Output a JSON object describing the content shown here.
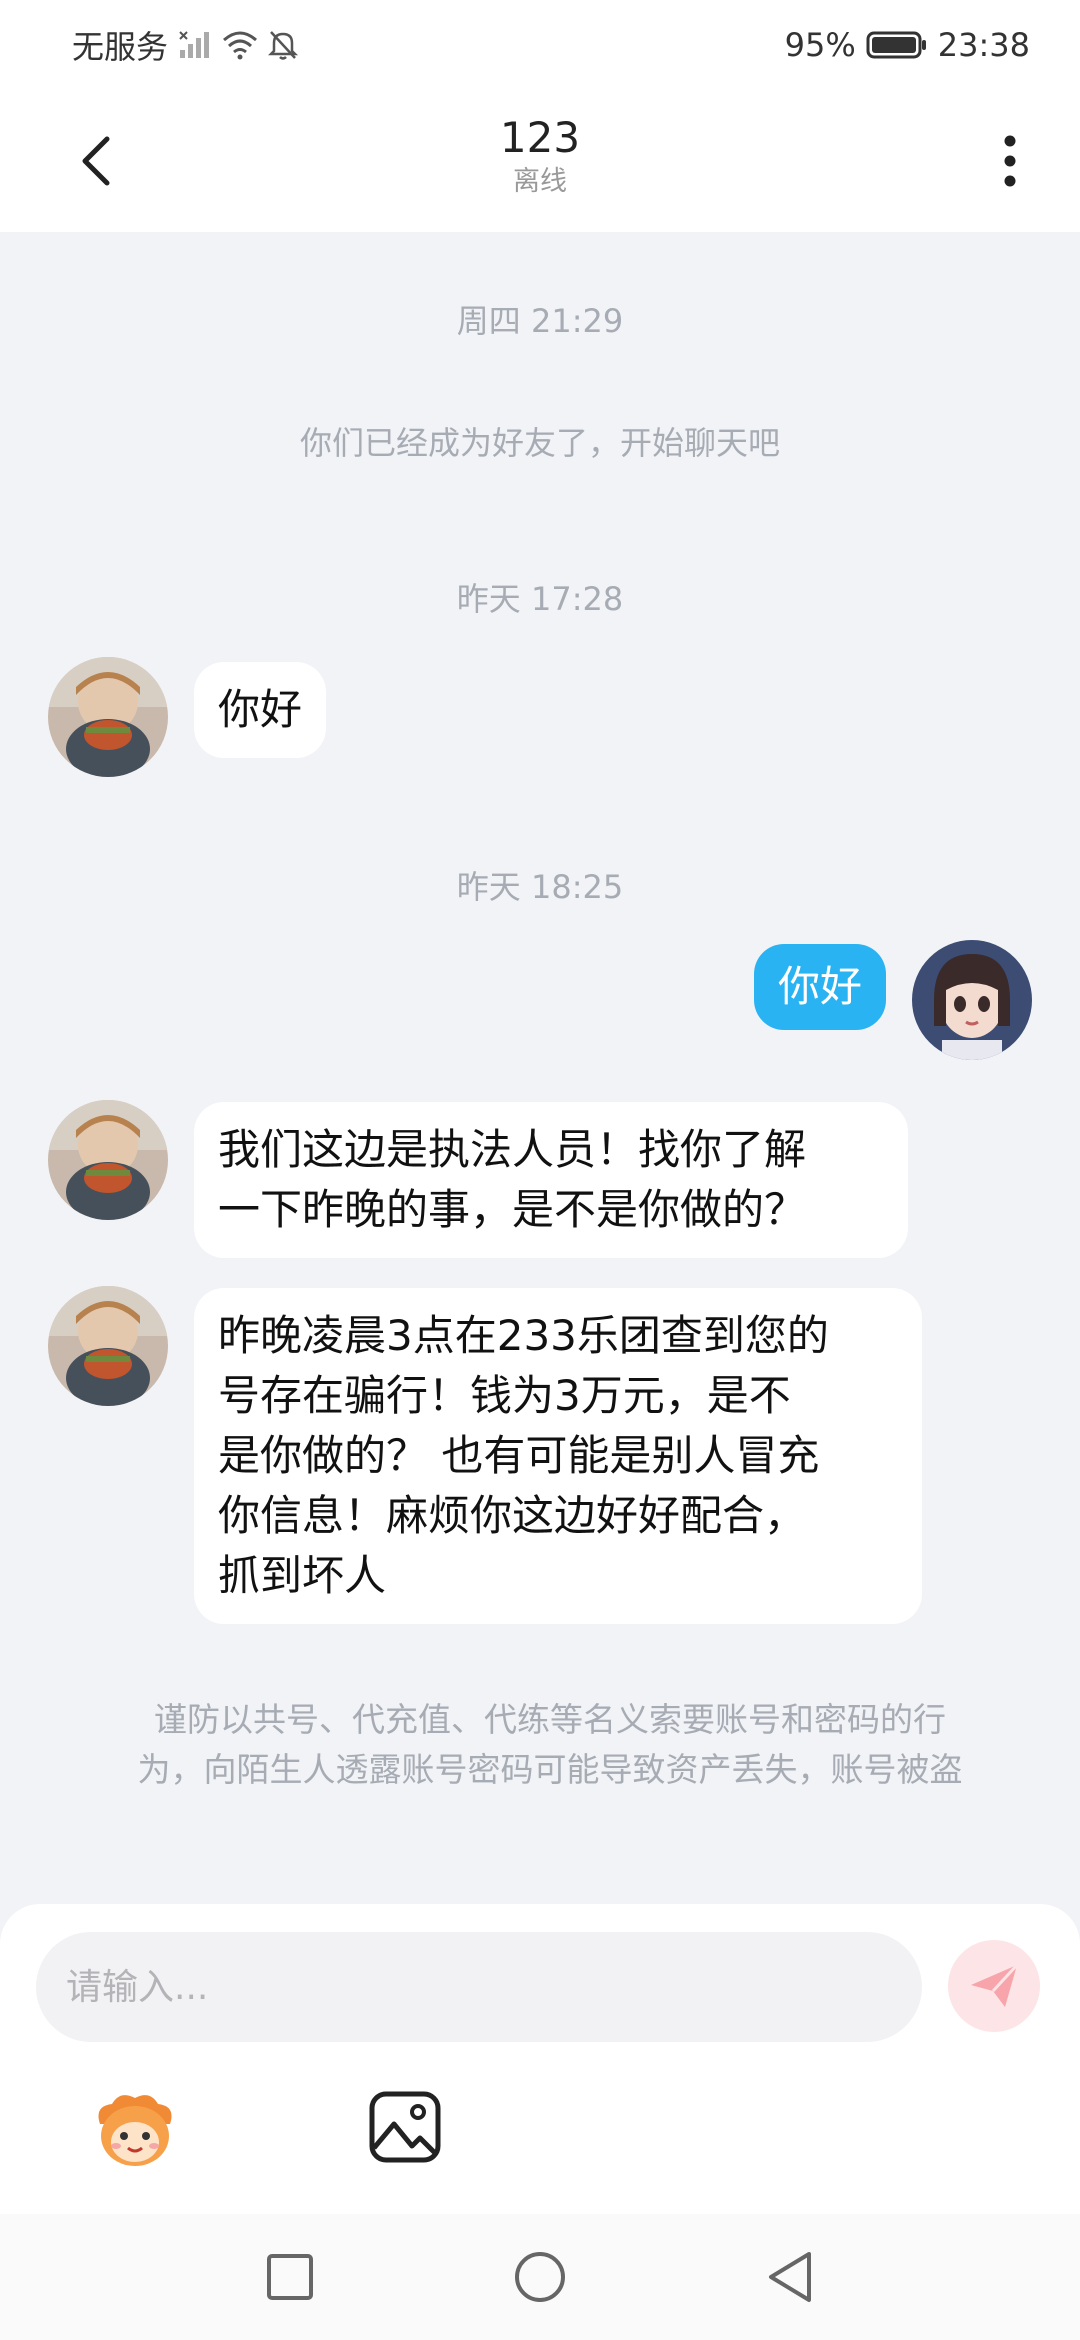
{
  "status_bar": {
    "carrier": "无服务",
    "battery": "95%",
    "time": "23:38"
  },
  "header": {
    "title": "123",
    "subtitle": "离线"
  },
  "chat": {
    "entries": [
      {
        "type": "time",
        "text": "周四 21:29"
      },
      {
        "type": "system",
        "text": "你们已经成为好友了，开始聊天吧"
      },
      {
        "type": "time",
        "text": "昨天 17:28"
      },
      {
        "type": "message",
        "side": "left",
        "text": "你好"
      },
      {
        "type": "time",
        "text": "昨天 18:25"
      },
      {
        "type": "message",
        "side": "right",
        "text": "你好"
      },
      {
        "type": "message",
        "side": "left",
        "lines": [
          "我们这边是执法人员！找你了解",
          "一下昨晚的事，是不是你做的？"
        ]
      },
      {
        "type": "message",
        "side": "left",
        "lines": [
          "昨晚凌晨3点在233乐团查到您的",
          "号存在骗行！钱为3万元，是不",
          "是你做的？ 也有可能是别人冒充",
          "你信息！麻烦你这边好好配合，",
          "抓到坏人"
        ]
      }
    ],
    "warning_lines": [
      "谨防以共号、代充值、代练等名义索要账号和密码的行",
      "为，向陌生人透露账号密码可能导致资产丢失，账号被盗"
    ]
  },
  "input": {
    "placeholder": "请输入..."
  },
  "colors": {
    "my_bubble": "#2ab3f2",
    "background": "#f1f3f7",
    "send_button_bg": "#fde4e6",
    "send_icon": "#f7a4ab"
  },
  "icons": {
    "back": "back-arrow-icon",
    "more": "more-vertical-icon",
    "send": "send-paper-plane-icon",
    "emoji": "mascot-emoji-icon",
    "image": "image-picture-icon"
  }
}
